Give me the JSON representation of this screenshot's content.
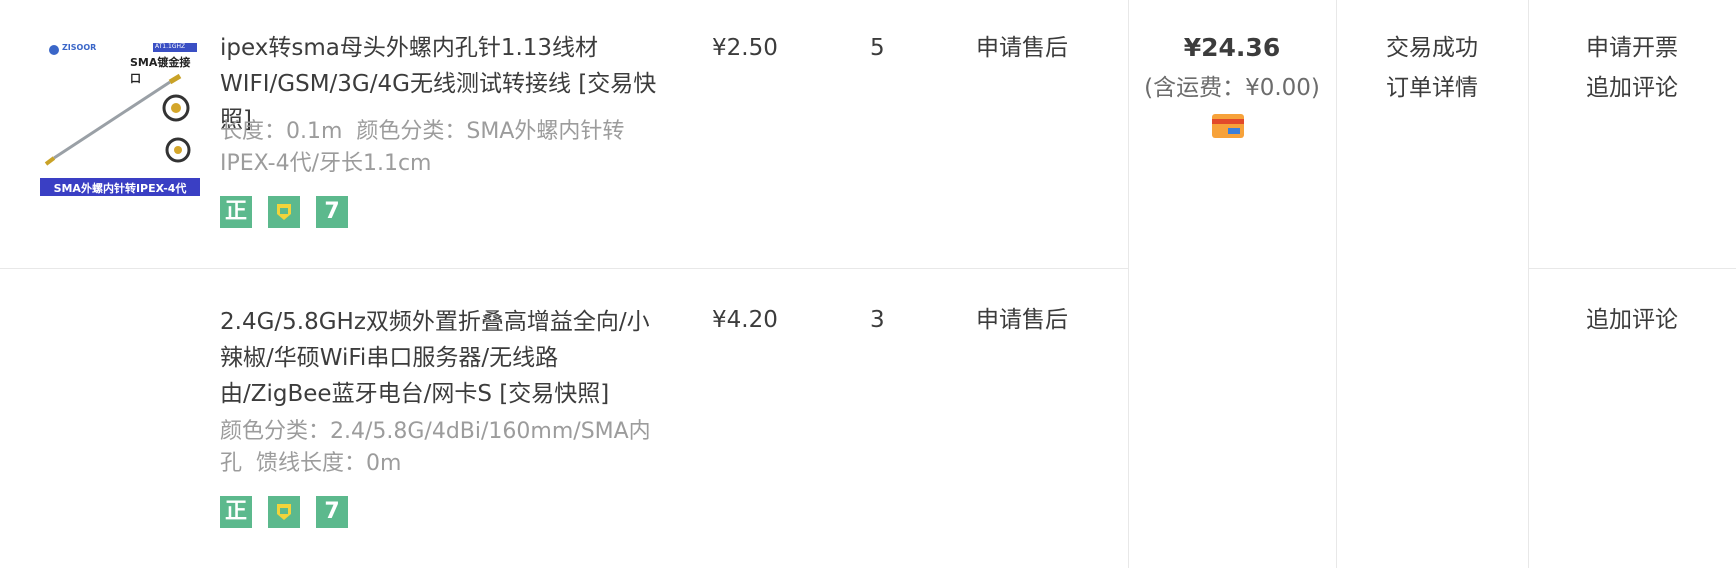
{
  "orders": [
    {
      "thumbnail": {
        "brand": "ZISOOR",
        "tag": "AT1.1GHZ",
        "heading": "SMA镀金接口",
        "caption": "SMA外螺内针转IPEX-4代"
      },
      "title": "ipex转sma母头外螺内孔针1.13线材WIFI/GSM/3G/4G无线测试转接线",
      "snapshot_link": "[交易快照]",
      "sku": [
        "长度：0.1m",
        "颜色分类：SMA外螺内针转IPEX-4代/牙长1.1cm"
      ],
      "price": "¥2.50",
      "quantity": "5",
      "after_sale": "申请售后",
      "service_badges": [
        "正",
        "保",
        "7"
      ],
      "actions": [
        "申请开票",
        "追加评论"
      ]
    },
    {
      "title": "2.4G/5.8GHz双频外置折叠高增益全向/小辣椒/华硕WiFi串口服务器/无线路由/ZigBee蓝牙电台/网卡S",
      "snapshot_link": "[交易快照]",
      "sku": [
        "颜色分类：2.4/5.8G/4dBi/160mm/SMA内孔",
        "馈线长度：0m"
      ],
      "price": "¥4.20",
      "quantity": "3",
      "after_sale": "申请售后",
      "service_badges": [
        "正",
        "保",
        "7"
      ],
      "actions": [
        "追加评论"
      ]
    }
  ],
  "order_summary": {
    "total": "¥24.36",
    "shipping": "(含运费：¥0.00)",
    "payment_icon": "card-payment-icon",
    "status": "交易成功",
    "detail_link": "订单详情"
  },
  "colors": {
    "badge": "#5cb98d",
    "border": "#e8e8e8",
    "muted_text": "#9c9c9c",
    "text": "#3c3c3c"
  }
}
